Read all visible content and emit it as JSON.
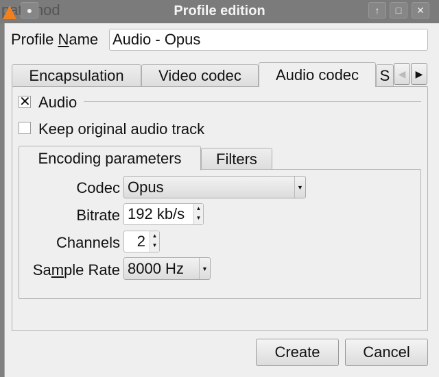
{
  "window": {
    "title": "Profile edition",
    "background_text": "patomod"
  },
  "profile": {
    "label_pre": "Profile ",
    "label_mnemonic": "N",
    "label_post": "ame",
    "value": "Audio - Opus"
  },
  "tabs": [
    {
      "label": "Encapsulation"
    },
    {
      "label": "Video codec"
    },
    {
      "label": "Audio codec",
      "active": true
    },
    {
      "label": "S"
    }
  ],
  "audio": {
    "label": "Audio",
    "checked": true,
    "keep_label": "Keep original audio track",
    "keep_checked": false
  },
  "subtabs": [
    {
      "label": "Encoding parameters",
      "active": true
    },
    {
      "label": "Filters"
    }
  ],
  "fields": {
    "codec_label": "Codec",
    "codec_value": "Opus",
    "bitrate_label": "Bitrate",
    "bitrate_value": "192 kb/s",
    "channels_label": "Channels",
    "channels_value": "2",
    "sr_pre": "Sa",
    "sr_mn": "m",
    "sr_post": "ple Rate",
    "sr_value": "8000 Hz"
  },
  "buttons": {
    "create": "Create",
    "cancel": "Cancel"
  }
}
